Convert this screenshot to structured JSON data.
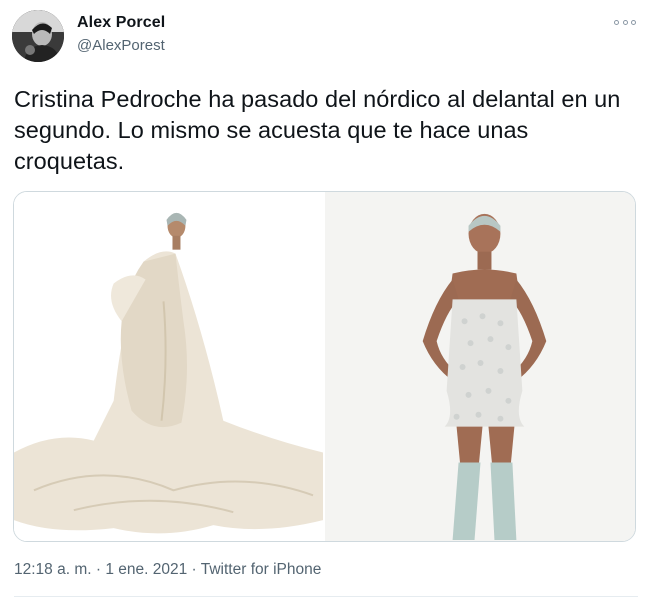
{
  "author": {
    "display_name": "Alex Porcel",
    "handle": "@AlexPorest"
  },
  "tweet": {
    "text": "Cristina Pedroche ha pasado del nórdico al delantal en un segundo. Lo mismo se acuesta que te hace unas croquetas.",
    "time": "12:18 a. m.",
    "separator": "·",
    "date": "1 ene. 2021",
    "source": "Twitter for iPhone"
  },
  "media": [
    {
      "icon": "photo-duvet-gown"
    },
    {
      "icon": "photo-sparkle-minidress"
    }
  ],
  "colors": {
    "text": "#0f1419",
    "secondary": "#536471",
    "border": "#cfd9de"
  }
}
